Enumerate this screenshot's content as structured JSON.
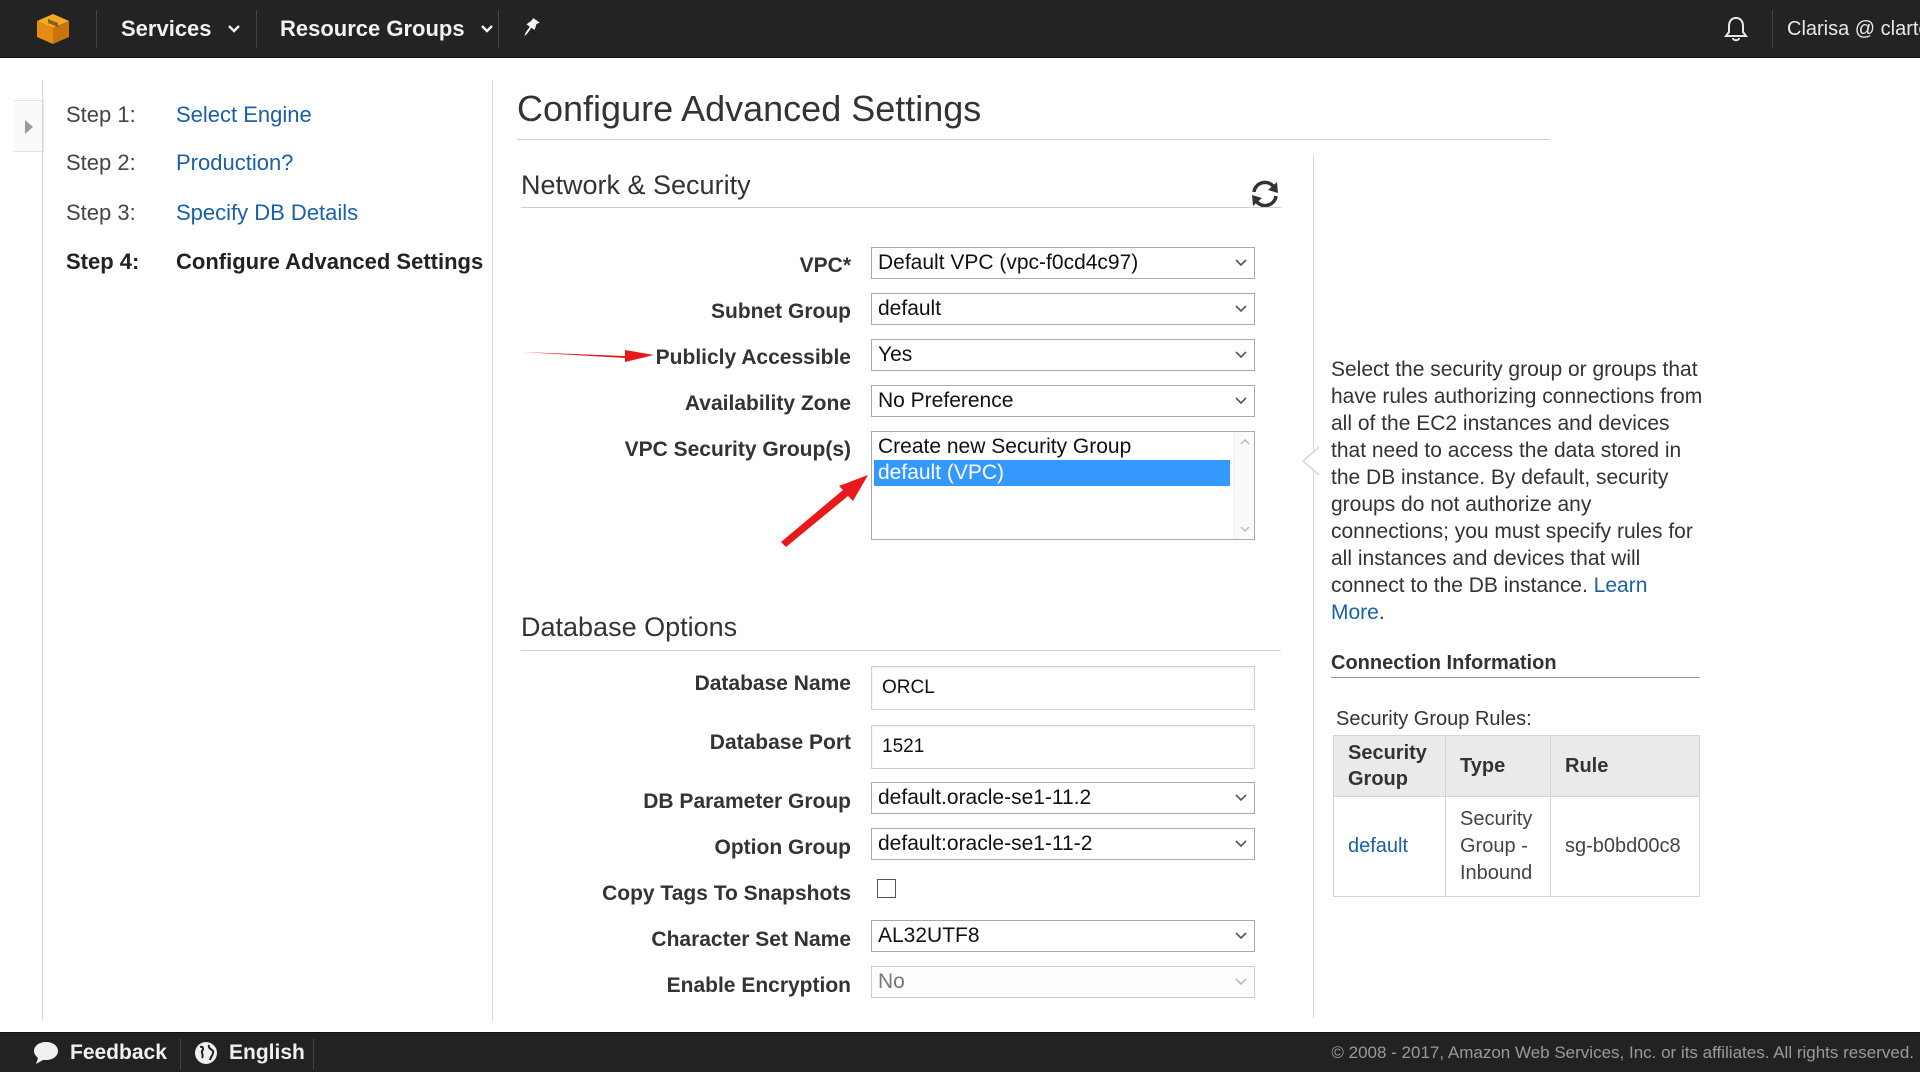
{
  "nav": {
    "services_label": "Services",
    "resource_groups_label": "Resource Groups",
    "user_label": "Clarisa @ clarte"
  },
  "steps": [
    {
      "num": "Step 1:",
      "label": "Select Engine"
    },
    {
      "num": "Step 2:",
      "label": "Production?"
    },
    {
      "num": "Step 3:",
      "label": "Specify DB Details"
    },
    {
      "num": "Step 4:",
      "label": "Configure Advanced Settings"
    }
  ],
  "page": {
    "title": "Configure Advanced Settings"
  },
  "network": {
    "section_title": "Network & Security",
    "vpc_label": "VPC*",
    "vpc_value": "Default VPC (vpc-f0cd4c97)",
    "subnet_label": "Subnet Group",
    "subnet_value": "default",
    "public_label": "Publicly Accessible",
    "public_value": "Yes",
    "az_label": "Availability Zone",
    "az_value": "No Preference",
    "sg_label": "VPC Security Group(s)",
    "sg_options": [
      "Create new Security Group",
      "default (VPC)"
    ]
  },
  "database": {
    "section_title": "Database Options",
    "name_label": "Database Name",
    "name_value": "ORCL",
    "port_label": "Database Port",
    "port_value": "1521",
    "param_label": "DB Parameter Group",
    "param_value": "default.oracle-se1-11.2",
    "option_label": "Option Group",
    "option_value": "default:oracle-se1-11-2",
    "copy_tags_label": "Copy Tags To Snapshots",
    "charset_label": "Character Set Name",
    "charset_value": "AL32UTF8",
    "encryption_label": "Enable Encryption",
    "encryption_value": "No"
  },
  "help": {
    "text": "Select the security group or groups that have rules authorizing connections from all of the EC2 instances and devices that need to access the data stored in the DB instance. By default, security groups do not authorize any connections; you must specify rules for all instances and devices that will connect to the DB instance.",
    "learn_more": "Learn More",
    "period": ".",
    "conn_title": "Connection Information",
    "sg_rules_label": "Security Group Rules:",
    "table_headers": [
      "Security Group",
      "Type",
      "Rule"
    ],
    "table_row": [
      "default",
      "Security Group - Inbound",
      "sg-b0bd00c8"
    ]
  },
  "footer": {
    "feedback": "Feedback",
    "language": "English",
    "copyright": "© 2008 - 2017, Amazon Web Services, Inc. or its affiliates. All rights reserved."
  },
  "colors": {
    "topbar": "#232323",
    "link": "#1a5fa8",
    "selection": "#3399ff",
    "annotation_arrow": "#e8191c"
  }
}
